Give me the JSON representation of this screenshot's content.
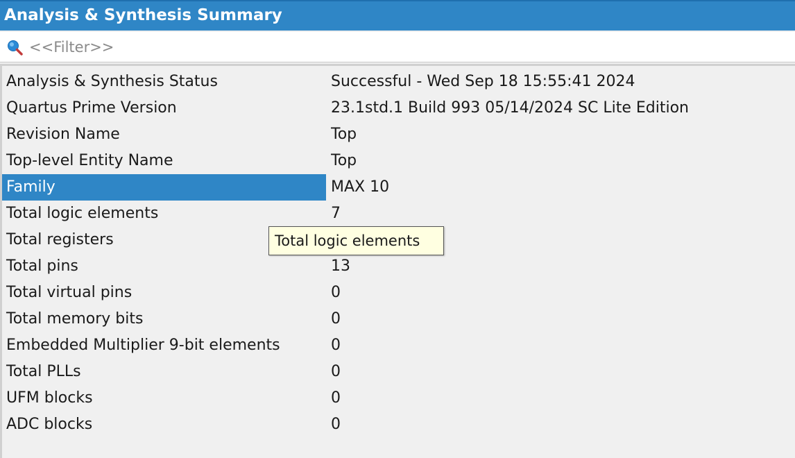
{
  "window": {
    "title": "Analysis & Synthesis Summary"
  },
  "filter": {
    "placeholder": "<<Filter>>",
    "icon": "search-icon"
  },
  "summary": {
    "rows": [
      {
        "label": "Analysis & Synthesis Status",
        "value": "Successful - Wed Sep 18 15:55:41 2024"
      },
      {
        "label": "Quartus Prime Version",
        "value": "23.1std.1 Build 993 05/14/2024 SC Lite Edition"
      },
      {
        "label": "Revision Name",
        "value": "Top"
      },
      {
        "label": "Top-level Entity Name",
        "value": "Top"
      },
      {
        "label": "Family",
        "value": "MAX 10"
      },
      {
        "label": "Total logic elements",
        "value": "7"
      },
      {
        "label": "Total registers",
        "value": ""
      },
      {
        "label": "Total pins",
        "value": "13"
      },
      {
        "label": "Total virtual pins",
        "value": "0"
      },
      {
        "label": "Total memory bits",
        "value": "0"
      },
      {
        "label": "Embedded Multiplier 9-bit elements",
        "value": "0"
      },
      {
        "label": "Total PLLs",
        "value": "0"
      },
      {
        "label": "UFM blocks",
        "value": "0"
      },
      {
        "label": "ADC blocks",
        "value": "0"
      }
    ],
    "selected_row": "Family"
  },
  "tooltip": {
    "text": "Total logic elements"
  },
  "colors": {
    "accent": "#2f86c6",
    "tooltip_bg": "#ffffe1",
    "panel_bg": "#f0f0f0"
  }
}
